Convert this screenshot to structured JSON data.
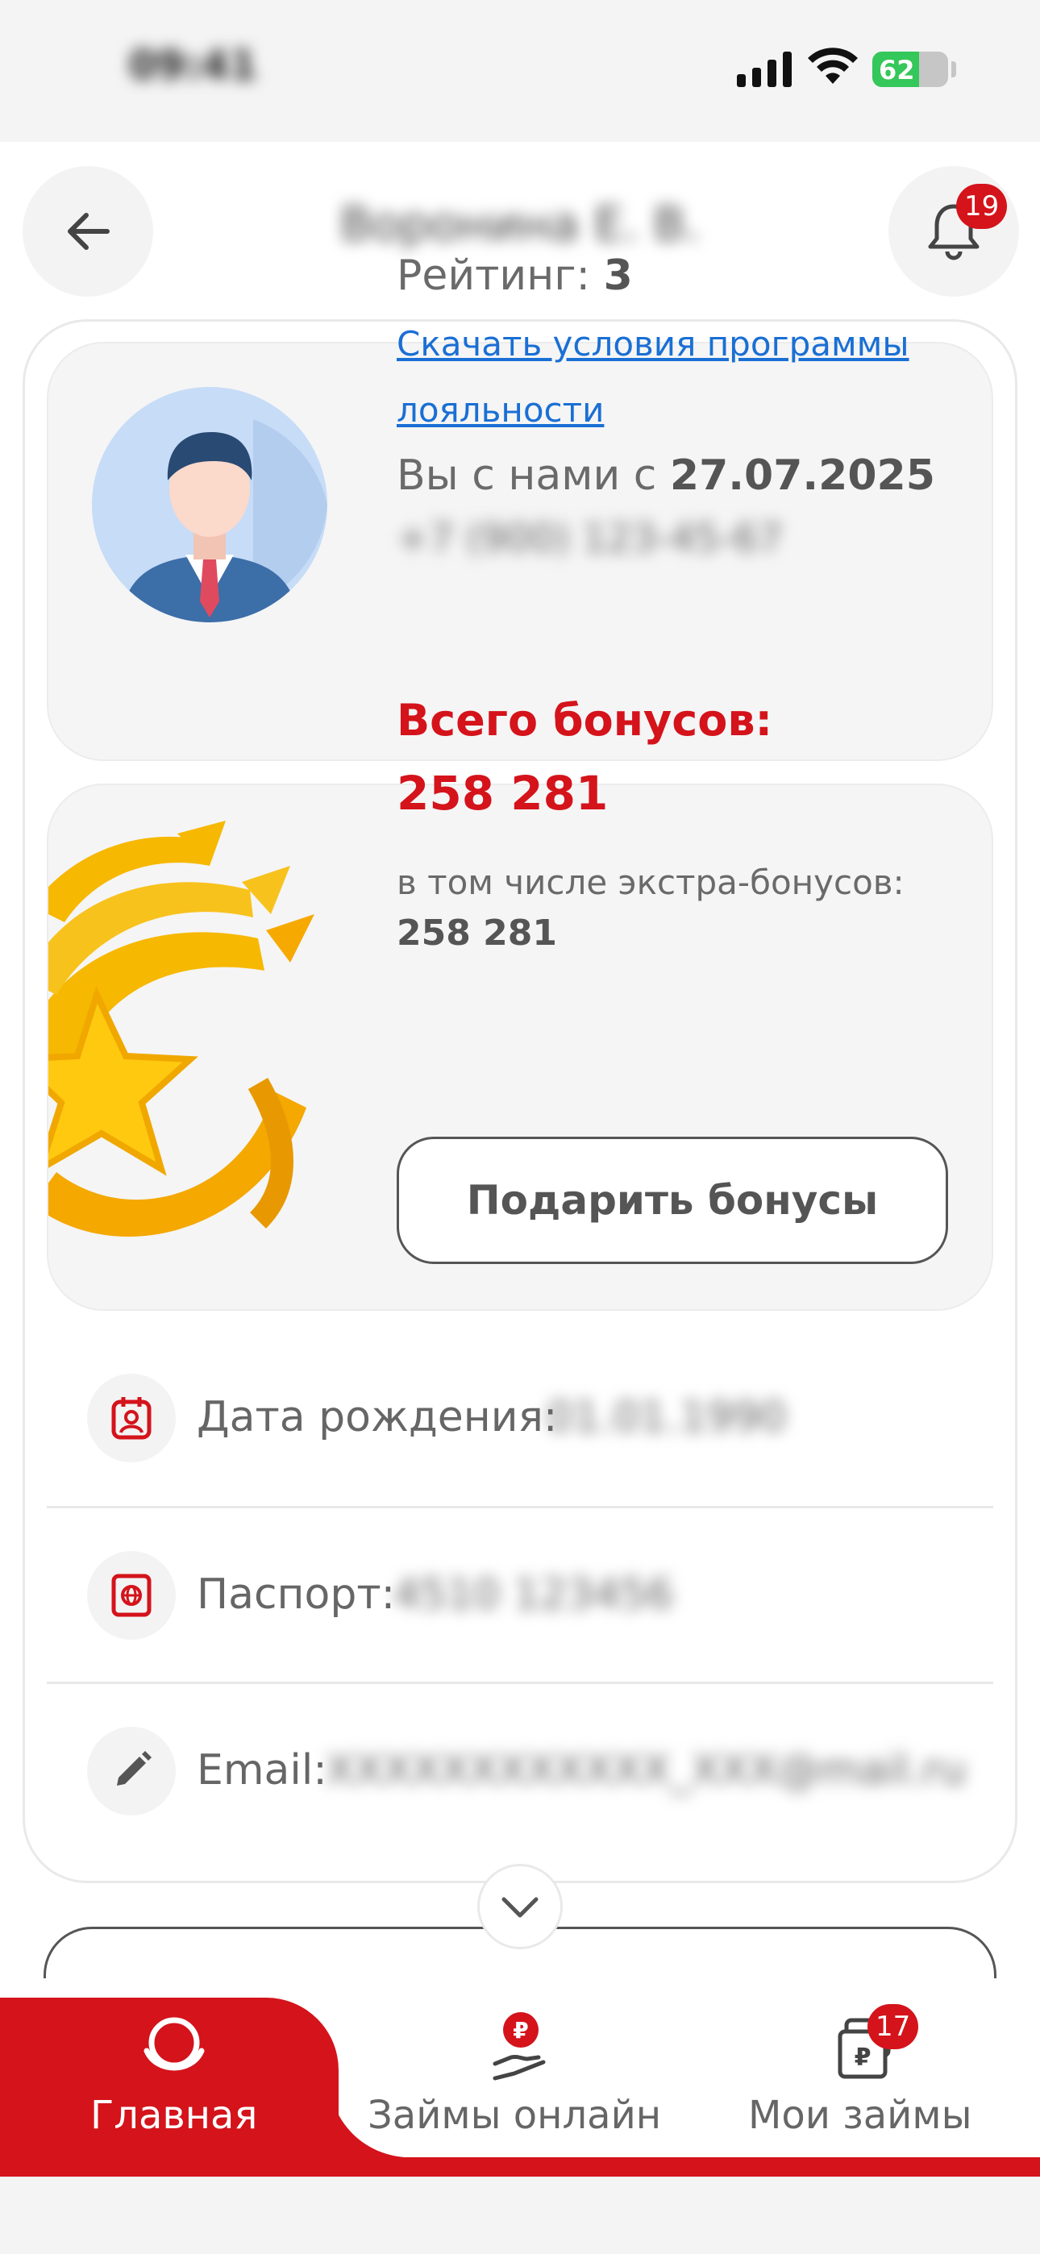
{
  "status_bar": {
    "time": "09:41",
    "battery": "62"
  },
  "header": {
    "title": "Воронина Е. В.",
    "notifications_count": "19"
  },
  "profile": {
    "rating_label": "Рейтинг:",
    "rating_value": "3",
    "download_link": "Скачать условия программы лояльности",
    "since_label": "Вы с нами с",
    "since_date": "27.07.2025",
    "phone": "+7 (900) 123-45-67"
  },
  "bonus": {
    "title": "Всего бонусов:",
    "total": "258 281",
    "extra_label": "в том числе экстра-бонусов:",
    "extra_value": "258 281",
    "gift_button": "Подарить бонусы"
  },
  "info": {
    "birthdate_label": "Дата рождения:",
    "birthdate_value": "01.01.1990",
    "passport_label": "Паспорт:",
    "passport_value": "4510 123456",
    "email_label": "Email:",
    "email_value": "XXXXXXXXXXXX_XXX@mail.ru"
  },
  "nav": {
    "home": "Главная",
    "loans_online": "Займы онлайн",
    "my_loans": "Мои займы",
    "my_loans_badge": "17"
  },
  "colors": {
    "brand_red": "#d4131b",
    "link_blue": "#1a6fd4"
  }
}
